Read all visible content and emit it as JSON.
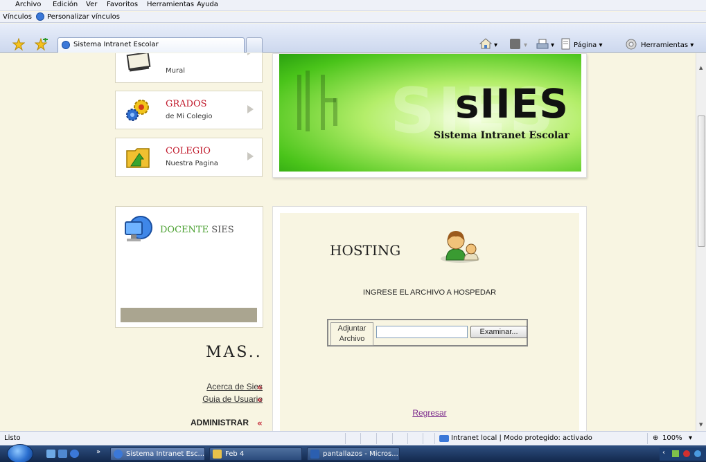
{
  "menubar": {
    "items": [
      "Archivo",
      "Edición",
      "Ver",
      "Favoritos",
      "Herramientas",
      "Ayuda"
    ]
  },
  "linksbar": {
    "label": "Vínculos",
    "link": "Personalizar vínculos"
  },
  "tabbar": {
    "tab_title": "Sistema Intranet Escolar",
    "commands": {
      "page": "Página ▾",
      "tools": "Herramientas ▾"
    }
  },
  "nav": {
    "mural": {
      "subtitle": "Mural"
    },
    "grados": {
      "title": "GRADOS",
      "subtitle": "de Mi Colegio"
    },
    "colegio": {
      "title": "COLEGIO",
      "subtitle": "Nuestra Pagina"
    }
  },
  "banner": {
    "logo": "sIIES",
    "tagline": "Sistema Intranet Escolar"
  },
  "docente": {
    "label_a": "DOCENTE",
    "label_b": "SIES"
  },
  "mas": {
    "title": "MAS..",
    "links": [
      "Acerca de Sies",
      "Guia de Usuario"
    ],
    "raquo": "«",
    "admin": "ADMINISTRAR"
  },
  "hosting": {
    "title": "HOSTING",
    "instruction": "INGRESE EL ARCHIVO A HOSPEDAR",
    "upload_label": "Adjuntar Archivo",
    "browse_button": "Examinar...",
    "back_link": "Regresar"
  },
  "statusbar": {
    "status": "Listo",
    "zone": "Intranet local | Modo protegido: activado",
    "zoom": "100%"
  },
  "taskbar": {
    "tasks": [
      "Sistema Intranet Esc...",
      "Feb 4",
      "pantallazos - Micros..."
    ]
  },
  "colors": {
    "accent_red": "#c0182a",
    "banner_green": "#4ac41a",
    "page_bg": "#f8f5e2",
    "link_visited": "#7b2a8c"
  }
}
